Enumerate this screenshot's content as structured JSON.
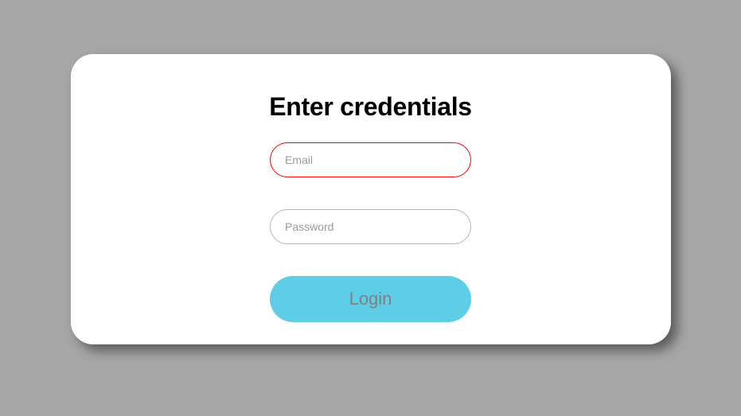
{
  "form": {
    "title": "Enter credentials",
    "email": {
      "placeholder": "Email",
      "value": "",
      "error": true
    },
    "password": {
      "placeholder": "Password",
      "value": ""
    },
    "submit_label": "Login"
  },
  "colors": {
    "background": "#a6a6a6",
    "card": "#ffffff",
    "accent": "#5ecee6",
    "error_border": "#ff0000"
  }
}
